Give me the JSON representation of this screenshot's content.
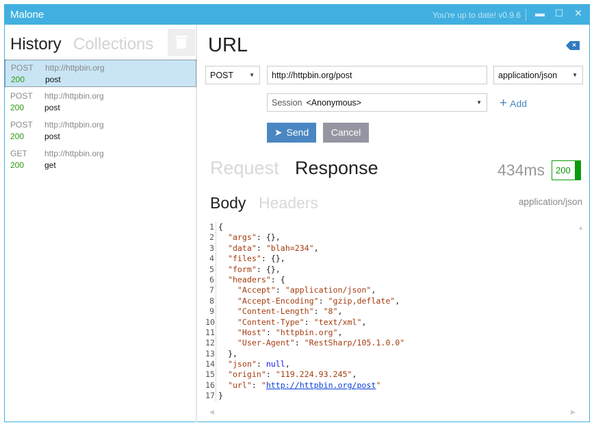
{
  "window": {
    "title": "Malone",
    "update_status": "You're up to date! v0.9.6",
    "minimize": "▬",
    "maximize": "☐",
    "close": "✕"
  },
  "sidebar": {
    "tabs": [
      {
        "label": "History",
        "active": true
      },
      {
        "label": "Collections",
        "active": false
      }
    ],
    "history": [
      {
        "method": "POST",
        "url": "http://httpbin.org",
        "status": "200",
        "name": "post",
        "selected": true
      },
      {
        "method": "POST",
        "url": "http://httpbin.org",
        "status": "200",
        "name": "post"
      },
      {
        "method": "POST",
        "url": "http://httpbin.org",
        "status": "200",
        "name": "post"
      },
      {
        "method": "GET",
        "url": "http://httpbin.org",
        "status": "200",
        "name": "get"
      }
    ]
  },
  "main": {
    "heading": "URL",
    "method": "POST",
    "url": "http://httpbin.org/post",
    "content_type": "application/json",
    "session_label": "Session",
    "session_value": "<Anonymous>",
    "add_label": "Add",
    "add_icon": "+",
    "send_label": "Send",
    "cancel_label": "Cancel",
    "tabs": [
      "Request",
      "Response"
    ],
    "active_tab": "Response",
    "elapsed": "434ms",
    "status_code": "200",
    "subtabs": [
      "Body",
      "Headers"
    ],
    "active_subtab": "Body",
    "response_type": "application/json"
  },
  "colors": {
    "accent": "#41b0e0",
    "send": "#4a87c2",
    "cancel": "#9496a2",
    "success": "#0a9a0a"
  },
  "body_lines": [
    [
      [
        "p",
        "{"
      ]
    ],
    [
      [
        "p",
        "  "
      ],
      [
        "k",
        "\"args\""
      ],
      [
        "p",
        ": {},"
      ]
    ],
    [
      [
        "p",
        "  "
      ],
      [
        "k",
        "\"data\""
      ],
      [
        "p",
        ": "
      ],
      [
        "s",
        "\"blah=234\""
      ],
      [
        "p",
        ","
      ]
    ],
    [
      [
        "p",
        "  "
      ],
      [
        "k",
        "\"files\""
      ],
      [
        "p",
        ": {},"
      ]
    ],
    [
      [
        "p",
        "  "
      ],
      [
        "k",
        "\"form\""
      ],
      [
        "p",
        ": {},"
      ]
    ],
    [
      [
        "p",
        "  "
      ],
      [
        "k",
        "\"headers\""
      ],
      [
        "p",
        ": {"
      ]
    ],
    [
      [
        "p",
        "    "
      ],
      [
        "k",
        "\"Accept\""
      ],
      [
        "p",
        ": "
      ],
      [
        "s",
        "\"application/json\""
      ],
      [
        "p",
        ","
      ]
    ],
    [
      [
        "p",
        "    "
      ],
      [
        "k",
        "\"Accept-Encoding\""
      ],
      [
        "p",
        ": "
      ],
      [
        "s",
        "\"gzip,deflate\""
      ],
      [
        "p",
        ","
      ]
    ],
    [
      [
        "p",
        "    "
      ],
      [
        "k",
        "\"Content-Length\""
      ],
      [
        "p",
        ": "
      ],
      [
        "s",
        "\"8\""
      ],
      [
        "p",
        ","
      ]
    ],
    [
      [
        "p",
        "    "
      ],
      [
        "k",
        "\"Content-Type\""
      ],
      [
        "p",
        ": "
      ],
      [
        "s",
        "\"text/xml\""
      ],
      [
        "p",
        ","
      ]
    ],
    [
      [
        "p",
        "    "
      ],
      [
        "k",
        "\"Host\""
      ],
      [
        "p",
        ": "
      ],
      [
        "s",
        "\"httpbin.org\""
      ],
      [
        "p",
        ","
      ]
    ],
    [
      [
        "p",
        "    "
      ],
      [
        "k",
        "\"User-Agent\""
      ],
      [
        "p",
        ": "
      ],
      [
        "s",
        "\"RestSharp/105.1.0.0\""
      ]
    ],
    [
      [
        "p",
        "  },"
      ]
    ],
    [
      [
        "p",
        "  "
      ],
      [
        "k",
        "\"json\""
      ],
      [
        "p",
        ": "
      ],
      [
        "n",
        "null"
      ],
      [
        "p",
        ","
      ]
    ],
    [
      [
        "p",
        "  "
      ],
      [
        "k",
        "\"origin\""
      ],
      [
        "p",
        ": "
      ],
      [
        "s",
        "\"119.224.93.245\""
      ],
      [
        "p",
        ","
      ]
    ],
    [
      [
        "p",
        "  "
      ],
      [
        "k",
        "\"url\""
      ],
      [
        "p",
        ": "
      ],
      [
        "s",
        "\""
      ],
      [
        "u",
        "http://httpbin.org/post"
      ],
      [
        "s",
        "\""
      ]
    ],
    [
      [
        "p",
        "}"
      ]
    ]
  ]
}
